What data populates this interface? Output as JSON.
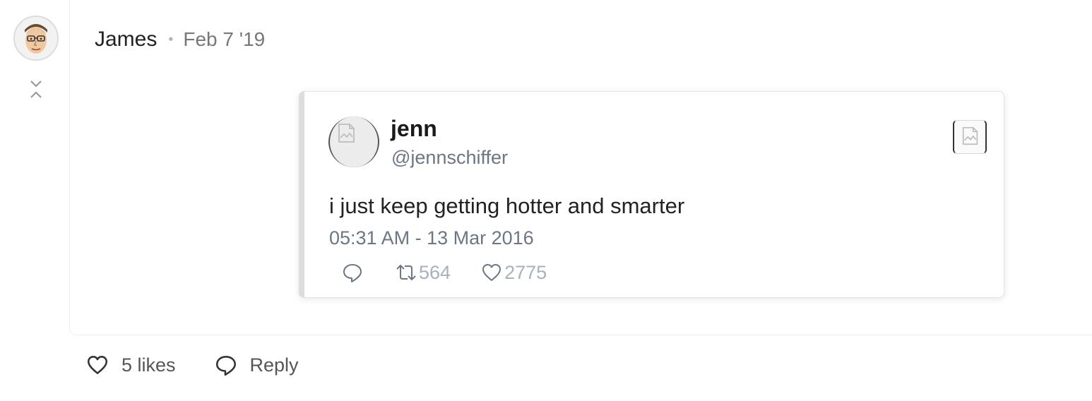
{
  "post": {
    "username": "James",
    "separator": "•",
    "date": "Feb 7 '19"
  },
  "tweet": {
    "name": "jenn",
    "handle": "@jennschiffer",
    "text": "i just keep getting hotter and smarter",
    "timestamp": "05:31 AM - 13 Mar 2016",
    "retweets": "564",
    "likes": "2775"
  },
  "actions": {
    "likes_label": "5 likes",
    "reply_label": "Reply"
  },
  "icons": {
    "collapse": "chevron-collapse-icon",
    "tweet_reply": "speech-bubble-icon",
    "tweet_retweet": "retweet-icon",
    "tweet_like": "heart-icon",
    "post_like": "heart-icon",
    "post_reply": "speech-bubble-icon",
    "broken_image": "broken-image-icon"
  },
  "colors": {
    "muted_text": "#777777",
    "tweet_meta": "#6b7785",
    "tweet_actions": "#a8b1ba"
  }
}
